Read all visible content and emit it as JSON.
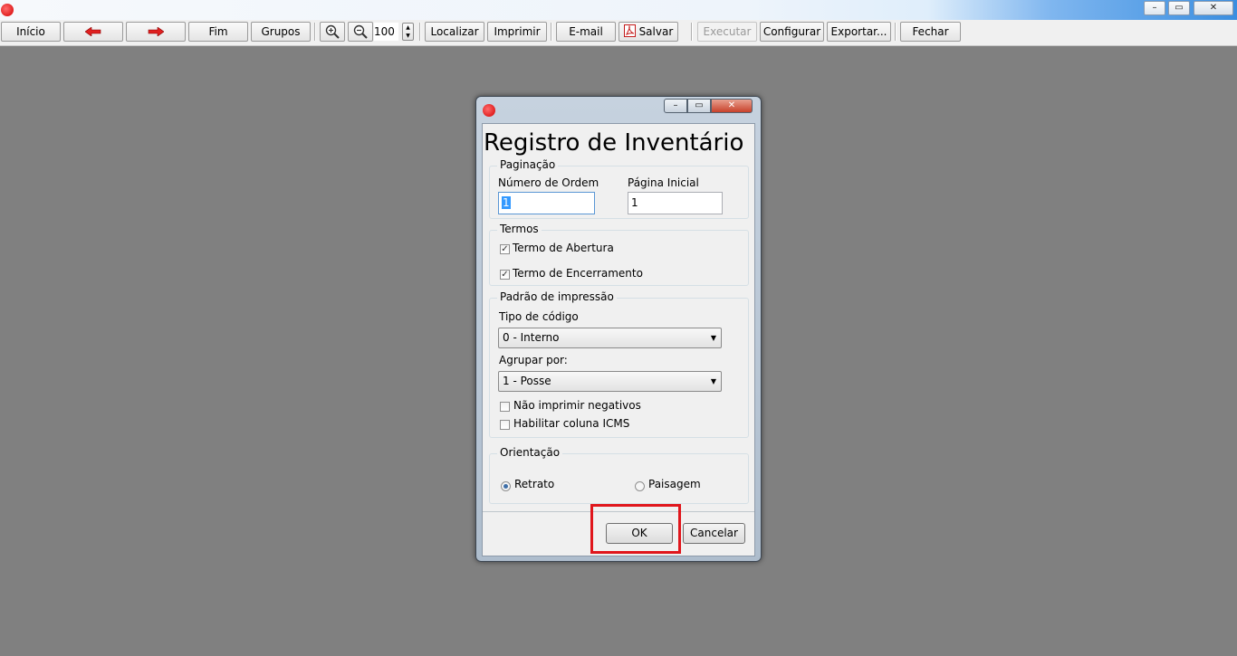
{
  "window": {
    "controls": {
      "minimize": "–",
      "maximize": "▭",
      "close": "✕"
    }
  },
  "toolbar": {
    "inicio": "Início",
    "prev_icon": "arrow-left-icon",
    "next_icon": "arrow-right-icon",
    "fim": "Fim",
    "grupos": "Grupos",
    "zoom_in_icon": "zoom-in-icon",
    "zoom_out_icon": "zoom-out-icon",
    "zoom_value": "100",
    "localizar": "Localizar",
    "imprimir": "Imprimir",
    "email": "E-mail",
    "salvar": "Salvar",
    "executar": "Executar",
    "configurar": "Configurar",
    "exportar": "Exportar...",
    "fechar": "Fechar"
  },
  "dialog": {
    "title": "Registro de Inventário",
    "paginacao": {
      "legend": "Paginação",
      "numero_label": "Número de Ordem",
      "numero_value": "1",
      "pagina_label": "Página Inicial",
      "pagina_value": "1"
    },
    "termos": {
      "legend": "Termos",
      "abertura": {
        "label": "Termo de Abertura",
        "checked": true
      },
      "encerramento": {
        "label": "Termo de Encerramento",
        "checked": true
      }
    },
    "padrao": {
      "legend": "Padrão de impressão",
      "tipo_label": "Tipo de código",
      "tipo_value": "0 - Interno",
      "agrupar_label": "Agrupar por:",
      "agrupar_value": "1 - Posse",
      "nao_imprimir": {
        "label": "Não imprimir negativos",
        "checked": false
      },
      "habilitar_icms": {
        "label": "Habilitar coluna ICMS",
        "checked": false
      }
    },
    "orientacao": {
      "legend": "Orientação",
      "retrato": {
        "label": "Retrato",
        "selected": true
      },
      "paisagem": {
        "label": "Paisagem",
        "selected": false
      }
    },
    "buttons": {
      "ok": "OK",
      "cancelar": "Cancelar"
    }
  },
  "colors": {
    "highlight": "#e0161c",
    "background": "#808080"
  }
}
